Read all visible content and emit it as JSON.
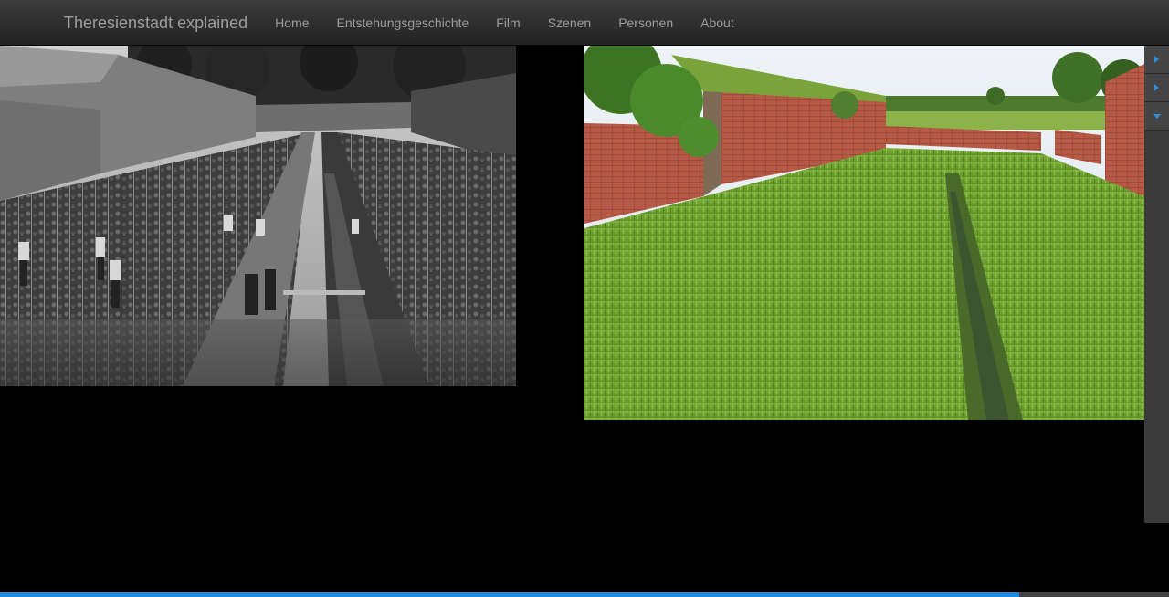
{
  "navbar": {
    "brand": "Theresienstadt explained",
    "items": [
      {
        "label": "Home"
      },
      {
        "label": "Entstehungsgeschichte"
      },
      {
        "label": "Film"
      },
      {
        "label": "Szenen"
      },
      {
        "label": "Personen"
      },
      {
        "label": "About"
      }
    ]
  },
  "images": {
    "left": {
      "description_icon": "historic-garden-photo"
    },
    "right": {
      "description_icon": "modern-moat-photo"
    }
  },
  "side_panel": {
    "buttons": [
      {
        "icon": "play-right-icon"
      },
      {
        "icon": "play-right-icon"
      },
      {
        "icon": "chevron-down-icon"
      }
    ]
  },
  "progress": {
    "fraction": 0.872,
    "fill_color": "#1f8ad9",
    "track_color": "#444444"
  }
}
